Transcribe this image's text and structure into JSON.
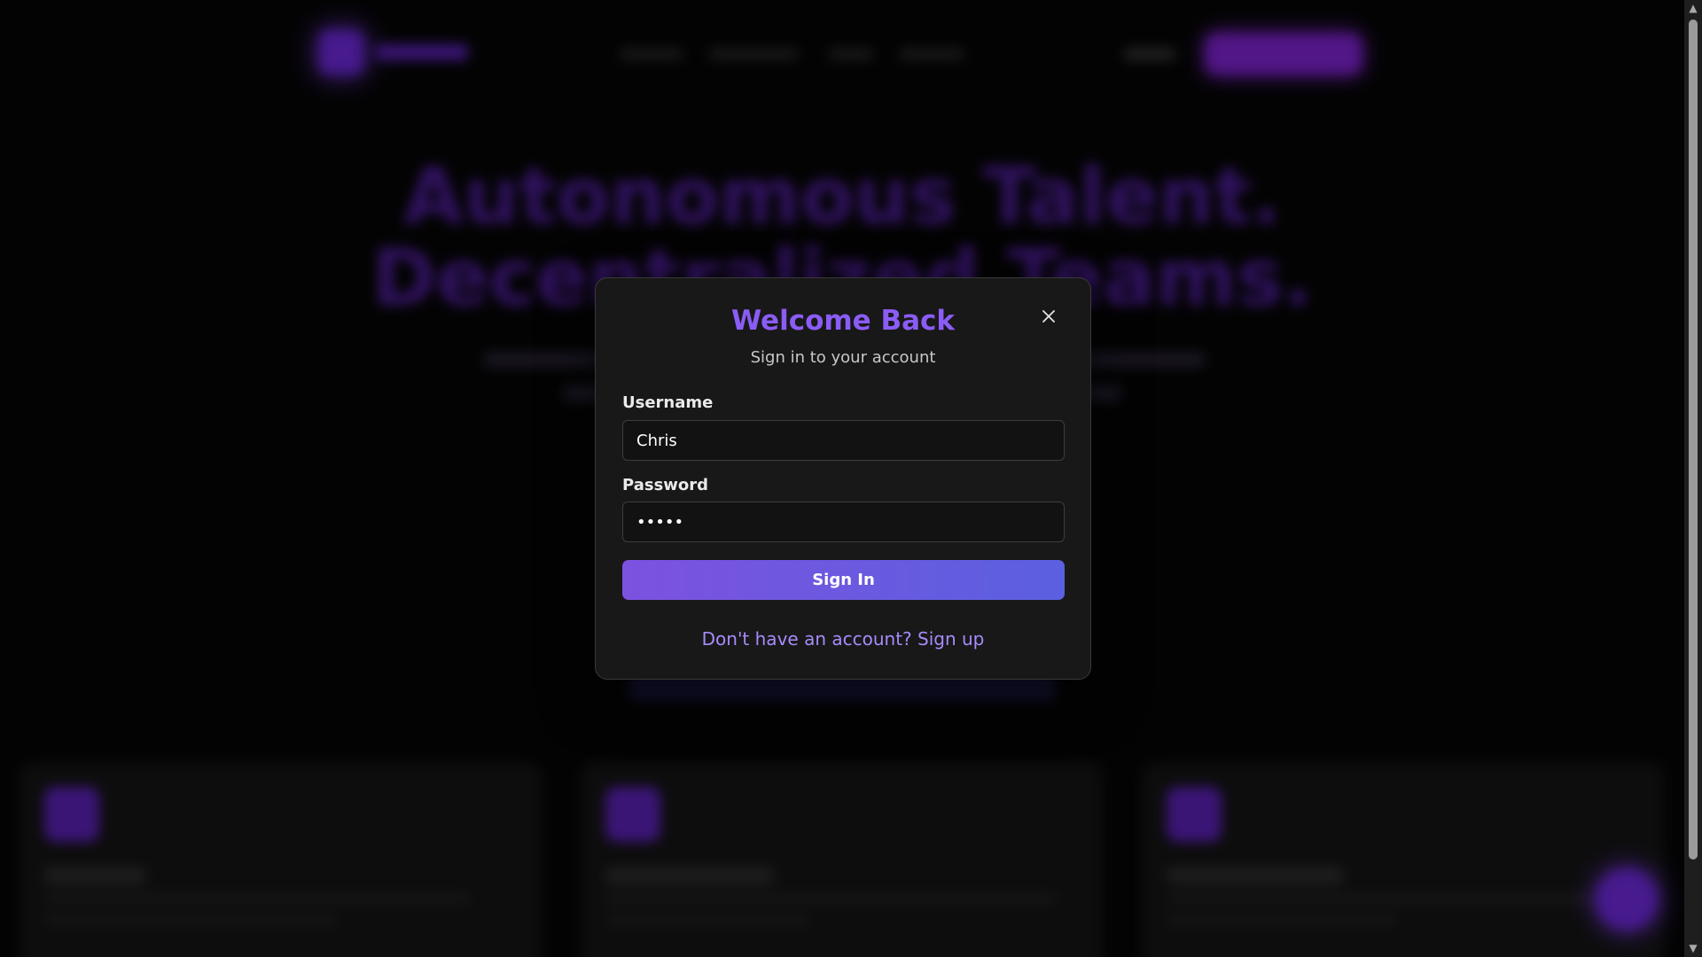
{
  "background": {
    "hero_line_1": "Autonomous Talent.",
    "hero_line_2": "Decentralized Teams."
  },
  "modal": {
    "title": "Welcome Back",
    "subtitle": "Sign in to your account",
    "close_icon": "close-icon",
    "username_label": "Username",
    "username_value": "Chris",
    "password_label": "Password",
    "password_value": "•••••",
    "submit_label": "Sign In",
    "signup_prompt": "Don't have an account? Sign up"
  },
  "colors": {
    "accent": "#8b5cf6",
    "button_gradient_start": "#7c52e0",
    "button_gradient_end": "#5b60e0",
    "link": "#a78bfa",
    "modal_bg": "#181818",
    "page_bg": "#060606"
  },
  "scrollbar": {
    "up_icon": "scroll-up-arrow-icon",
    "down_icon": "scroll-down-arrow-icon"
  }
}
